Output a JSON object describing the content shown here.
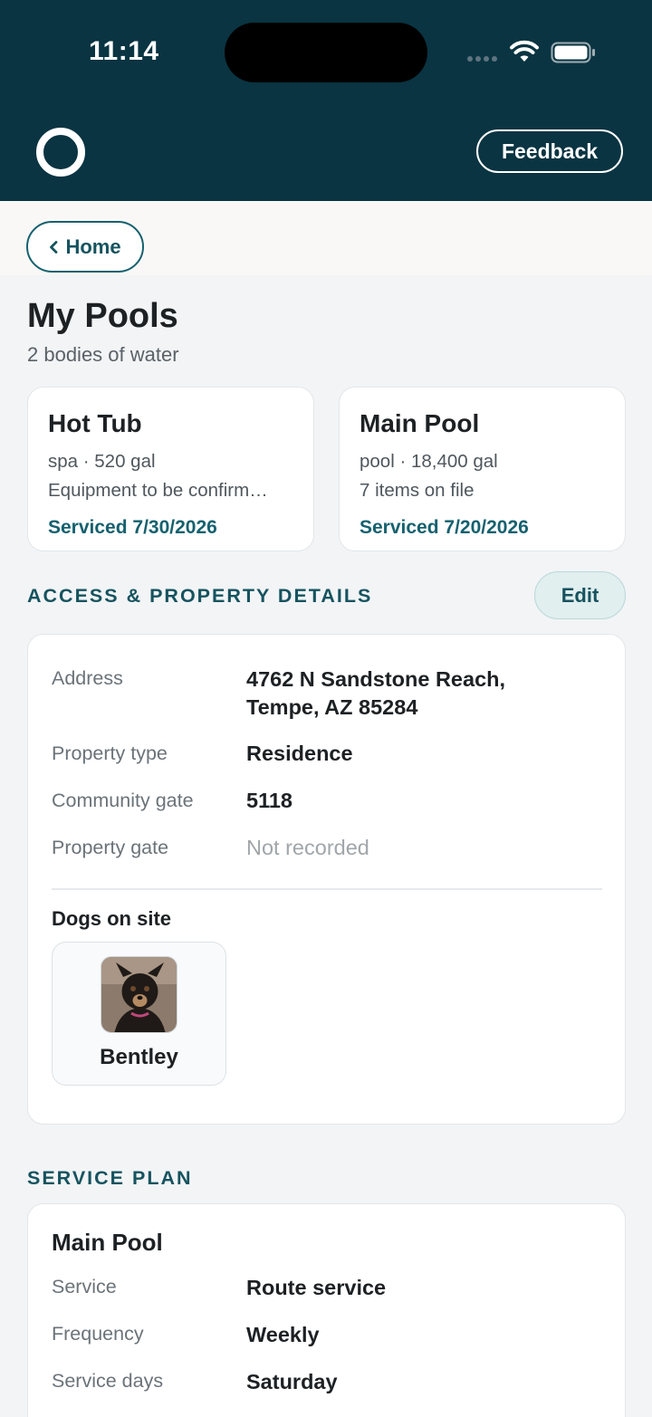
{
  "status_bar": {
    "time": "11:14"
  },
  "header": {
    "feedback_label": "Feedback"
  },
  "nav": {
    "home_label": "Home"
  },
  "page": {
    "title": "My Pools",
    "subtitle": "2 bodies of water"
  },
  "pools": [
    {
      "name": "Hot Tub",
      "line1": "spa · 520 gal",
      "line2": "Equipment to be confirm…",
      "serviced": "Serviced 7/30/2026"
    },
    {
      "name": "Main Pool",
      "line1": "pool · 18,400 gal",
      "line2": "7 items on file",
      "serviced": "Serviced 7/20/2026"
    }
  ],
  "access": {
    "heading": "ACCESS & PROPERTY DETAILS",
    "edit_label": "Edit",
    "rows": [
      {
        "label": "Address",
        "value_line1": "4762 N Sandstone Reach,",
        "value_line2": "Tempe, AZ 85284"
      },
      {
        "label": "Property type",
        "value": "Residence"
      },
      {
        "label": "Community gate",
        "value": "5118"
      },
      {
        "label": "Property gate",
        "value": "Not recorded"
      }
    ],
    "dogs_label": "Dogs on site",
    "dogs": [
      {
        "name": "Bentley"
      }
    ]
  },
  "service_plan": {
    "heading": "SERVICE PLAN",
    "pool_name": "Main Pool",
    "rows": [
      {
        "label": "Service",
        "value": "Route service"
      },
      {
        "label": "Frequency",
        "value": "Weekly"
      },
      {
        "label": "Service days",
        "value": "Saturday"
      }
    ]
  },
  "colors": {
    "header_bg": "#0a3442",
    "accent": "#16616f",
    "page_bg": "#f2f4f6"
  }
}
